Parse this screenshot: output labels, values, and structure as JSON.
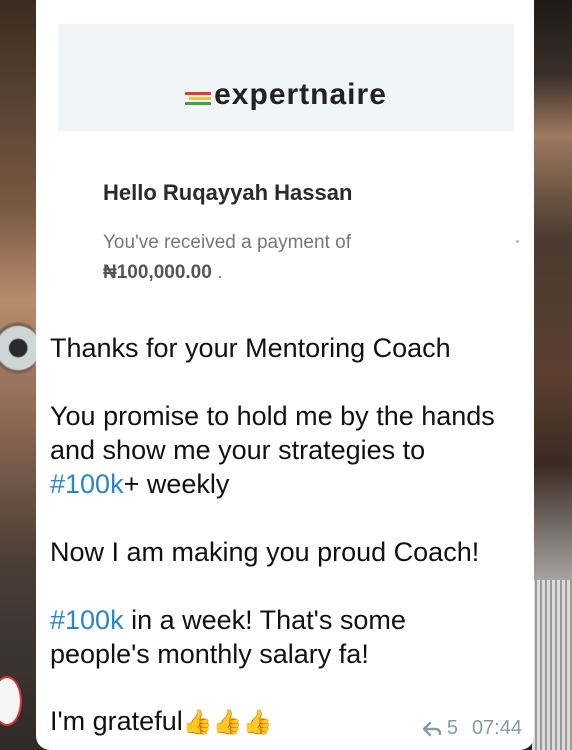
{
  "email": {
    "brand": "expertnaire",
    "greeting": "Hello Ruqayyah Hassan",
    "received_text": "You've received a payment of",
    "amount": "₦100,000.00",
    "amount_suffix": " ."
  },
  "message": {
    "line1": "Thanks for your Mentoring Coach",
    "line2": "You promise to hold me by the hands",
    "line3": "and show me your strategies to",
    "line4_tag": "#100k",
    "line4_rest": "+ weekly",
    "line5": "Now I am making you proud Coach!",
    "line6_tag": "#100k",
    "line6_rest": " in a week! That's some",
    "line7": "people's monthly salary fa!",
    "line8": "I'm grateful",
    "emojis": "👍👍👍"
  },
  "meta": {
    "reply_count": "5",
    "time": "07:44"
  },
  "colors": {
    "hashtag": "#2a86c8",
    "meta": "#8a9aa5"
  }
}
